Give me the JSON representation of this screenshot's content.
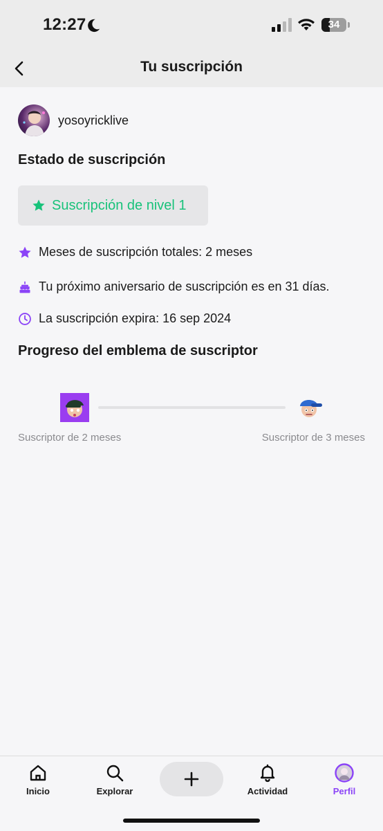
{
  "status_bar": {
    "time": "12:27",
    "battery_level": "34",
    "battery_fraction": 0.34,
    "icons": [
      "moon-icon",
      "signal-icon",
      "wifi-icon",
      "battery-icon"
    ]
  },
  "header": {
    "title": "Tu suscripción",
    "back_icon": "chevron-left-icon"
  },
  "profile": {
    "username": "yosoyricklive"
  },
  "status_section": {
    "title": "Estado de suscripción",
    "tier_label": "Suscripción de nivel 1",
    "tier_icon": "star-icon",
    "info": [
      {
        "icon": "star-icon",
        "text": "Meses de suscripción totales: 2 meses"
      },
      {
        "icon": "cake-icon",
        "text": "Tu próximo aniversario de suscripción es en 31 días."
      },
      {
        "icon": "clock-icon",
        "text": "La suscripción expira: 16 sep 2024"
      }
    ]
  },
  "badge_progress": {
    "title": "Progreso del emblema de suscriptor",
    "progress_fraction": 0,
    "current_badge": "Suscriptor de 2 meses",
    "next_badge": "Suscriptor de 3 meses"
  },
  "tab_bar": {
    "tabs": [
      {
        "label": "Inicio",
        "icon": "home-icon"
      },
      {
        "label": "Explorar",
        "icon": "search-icon"
      },
      {
        "label": "",
        "icon": "plus-icon"
      },
      {
        "label": "Actividad",
        "icon": "bell-icon"
      },
      {
        "label": "Perfil",
        "icon": "avatar"
      }
    ],
    "active": "Perfil"
  },
  "colors": {
    "accent": "#8b44f7",
    "tier_green": "#18c27a",
    "muted_text": "#8a8a8e"
  }
}
